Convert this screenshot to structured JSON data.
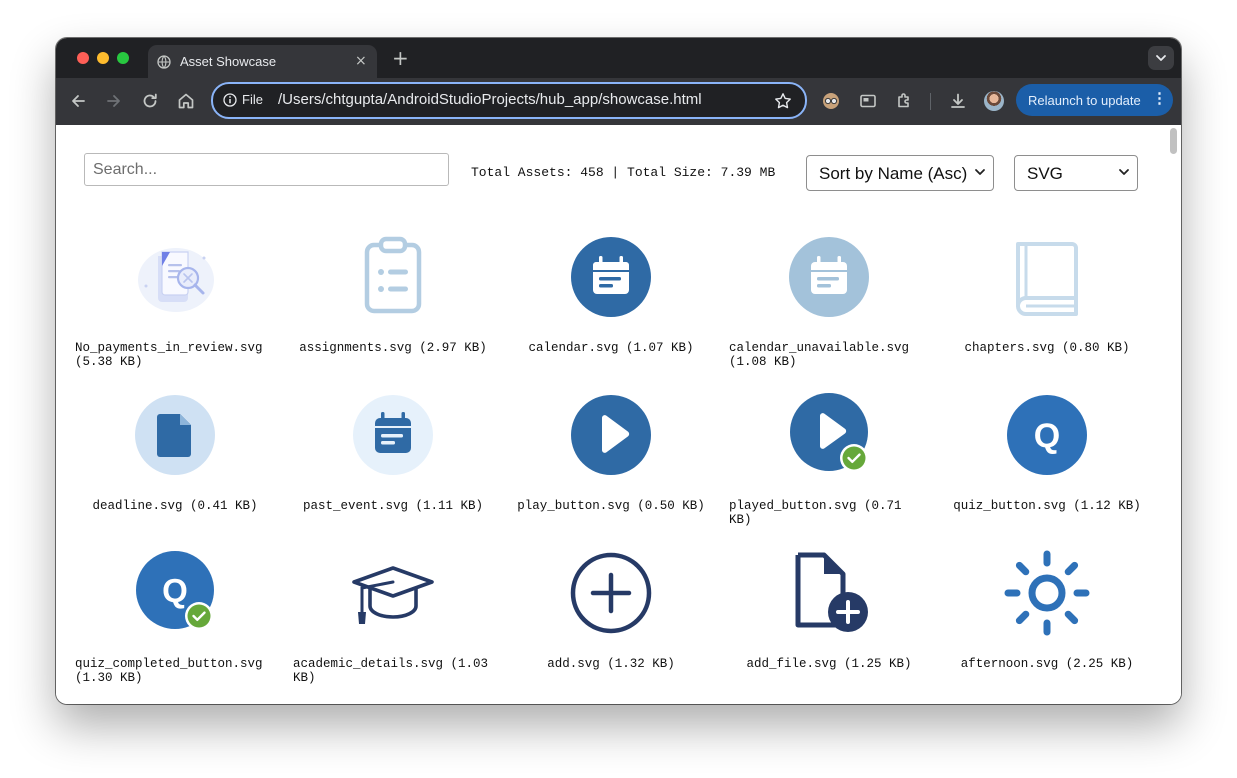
{
  "browser": {
    "tab_title": "Asset Showcase",
    "tab_close": "×",
    "new_tab": "+",
    "omnibox_scheme": "File",
    "url": "/Users/chtgupta/AndroidStudioProjects/hub_app/showcase.html",
    "relaunch_label": "Relaunch to update",
    "relaunch_menu": "⋮"
  },
  "controls": {
    "search_placeholder": "Search...",
    "stats": "Total Assets: 458 | Total Size: 7.39 MB",
    "sort_value": "Sort by Name (Asc)",
    "type_value": "SVG"
  },
  "colors": {
    "accent_blue": "#2f6aa5",
    "light_blue": "#9fc1da",
    "navy": "#263a66",
    "badge_green": "#66a83a"
  },
  "assets": [
    {
      "label": "No_payments_in_review.svg (5.38 KB)",
      "icon": "document-search-illustration",
      "align": "left"
    },
    {
      "label": "assignments.svg (2.97 KB)",
      "icon": "clipboard-list-icon",
      "align": "center"
    },
    {
      "label": "calendar.svg (1.07 KB)",
      "icon": "calendar-circle-icon",
      "align": "center"
    },
    {
      "label": "calendar_unavailable.svg (1.08 KB)",
      "icon": "calendar-unavailable-icon",
      "align": "left"
    },
    {
      "label": "chapters.svg (0.80 KB)",
      "icon": "book-icon",
      "align": "center"
    },
    {
      "label": "deadline.svg (0.41 KB)",
      "icon": "document-circle-icon",
      "align": "center"
    },
    {
      "label": "past_event.svg (1.11 KB)",
      "icon": "past-event-calendar-icon",
      "align": "center"
    },
    {
      "label": "play_button.svg (0.50 KB)",
      "icon": "play-button-icon",
      "align": "center"
    },
    {
      "label": "played_button.svg (0.71 KB)",
      "icon": "played-button-icon",
      "align": "left"
    },
    {
      "label": "quiz_button.svg (1.12 KB)",
      "icon": "quiz-button-icon",
      "align": "center"
    },
    {
      "label": "quiz_completed_button.svg (1.30 KB)",
      "icon": "quiz-completed-icon",
      "align": "left"
    },
    {
      "label": "academic_details.svg (1.03 KB)",
      "icon": "graduation-cap-icon",
      "align": "left"
    },
    {
      "label": "add.svg (1.32 KB)",
      "icon": "add-circle-icon",
      "align": "center"
    },
    {
      "label": "add_file.svg (1.25 KB)",
      "icon": "add-file-icon",
      "align": "center"
    },
    {
      "label": "afternoon.svg (2.25 KB)",
      "icon": "sun-icon",
      "align": "center"
    }
  ]
}
